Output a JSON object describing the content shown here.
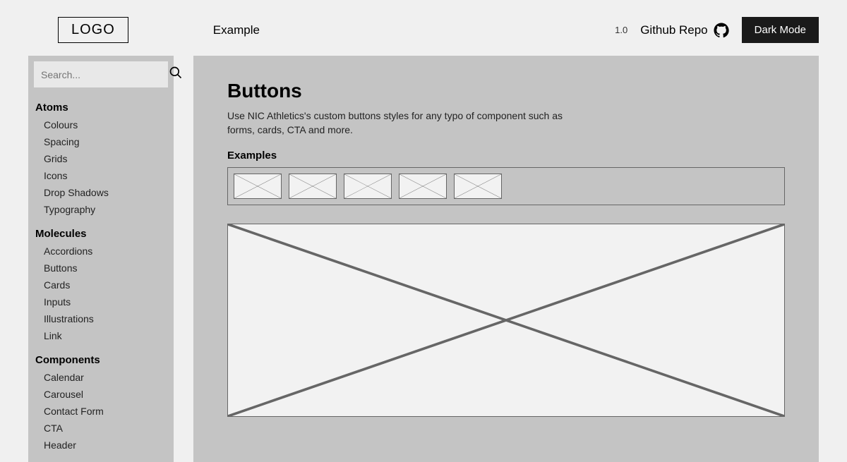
{
  "header": {
    "logo": "LOGO",
    "example_label": "Example",
    "version": "1.0",
    "github_label": "Github Repo",
    "dark_mode_label": "Dark Mode"
  },
  "sidebar": {
    "search_placeholder": "Search...",
    "sections": [
      {
        "heading": "Atoms",
        "items": [
          "Colours",
          "Spacing",
          "Grids",
          "Icons",
          "Drop Shadows",
          "Typography"
        ]
      },
      {
        "heading": "Molecules",
        "items": [
          "Accordions",
          "Buttons",
          "Cards",
          "Inputs",
          "Illustrations",
          "Link"
        ]
      },
      {
        "heading": "Components",
        "items": [
          "Calendar",
          "Carousel",
          "Contact Form",
          "CTA",
          "Header"
        ]
      }
    ]
  },
  "main": {
    "title": "Buttons",
    "description": "Use NIC Athletics's custom buttons styles for any typo of component such as forms, cards, CTA and more.",
    "examples_label": "Examples"
  }
}
